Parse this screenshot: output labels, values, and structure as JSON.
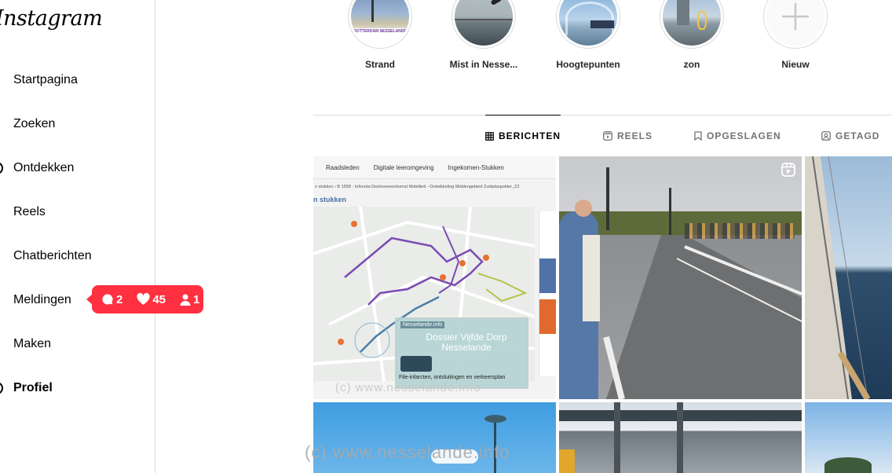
{
  "logo": "Instagram",
  "nav": [
    {
      "label": "Startpagina",
      "icon": "home-icon"
    },
    {
      "label": "Zoeken",
      "icon": "search-icon"
    },
    {
      "label": "Ontdekken",
      "icon": "compass-icon"
    },
    {
      "label": "Reels",
      "icon": "reels-icon"
    },
    {
      "label": "Chatberichten",
      "icon": "messenger-icon"
    },
    {
      "label": "Meldingen",
      "icon": "heart-icon"
    },
    {
      "label": "Maken",
      "icon": "plus-icon"
    },
    {
      "label": "Profiel",
      "icon": "profile-avatar"
    }
  ],
  "notifications": {
    "comments": "2",
    "likes": "45",
    "follows": "1"
  },
  "highlights": [
    {
      "label": "Strand"
    },
    {
      "label": "Mist in Nesse..."
    },
    {
      "label": "Hoogtepunten"
    },
    {
      "label": "zon"
    },
    {
      "label": "Nieuw"
    }
  ],
  "tabs": [
    {
      "label": "BERICHTEN",
      "icon": "grid-icon"
    },
    {
      "label": "REELS",
      "icon": "reels-icon"
    },
    {
      "label": "OPGESLAGEN",
      "icon": "bookmark-icon"
    },
    {
      "label": "GETAGD",
      "icon": "tagged-icon"
    }
  ],
  "post1": {
    "topbar": [
      "Raadsleden",
      "Digitale leeromgeving",
      "Ingekomen-Stukken"
    ],
    "breadcrumb": "n stukken › B 1558 · Infonota Deelovereenkomst Mobiliteit - Ontwikkeling Middengebied Zuidplaspolder_Z2",
    "heading": "n stukken",
    "card_tag": "Nesselande.info",
    "card_title": "Dossier Vijfde Dorp Nesselande",
    "card_caption": "File-infarcten, ontsluitingen en verkeersplan"
  },
  "watermark": "(c)  www.nesselande.info",
  "highlight_text_1": "ROTTERDAM NESSELANDE"
}
